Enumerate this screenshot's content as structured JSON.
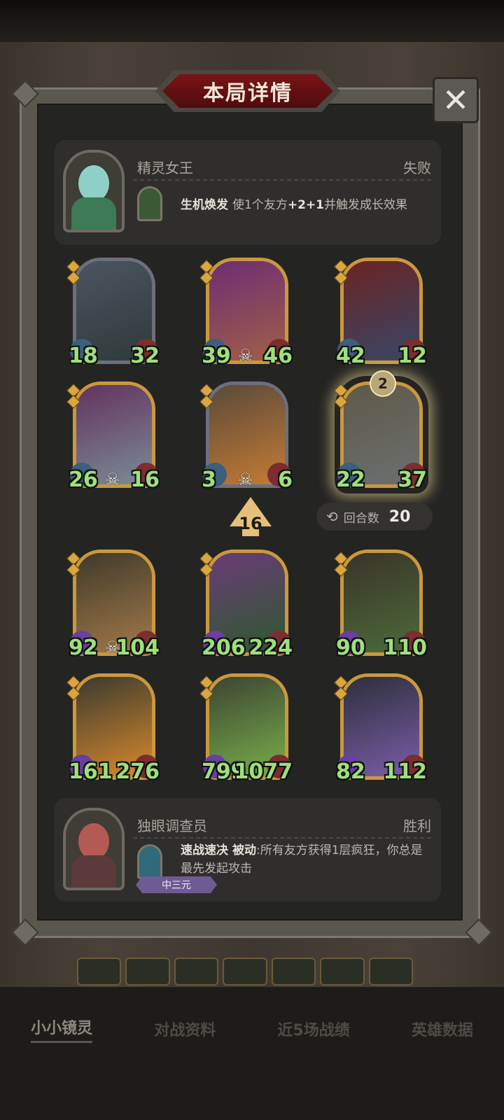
{
  "modal": {
    "title": "本局详情",
    "close_icon": "✕"
  },
  "top_player": {
    "name": "精灵女王",
    "result": "失败",
    "skill_name": "生机焕发",
    "skill_desc_pre": "使1个友方",
    "skill_desc_bold": "+2+1",
    "skill_desc_post": "并触发成长效果"
  },
  "top_cards": [
    {
      "atk": "18",
      "hp": "32",
      "skull": false,
      "frame": "gray",
      "colors": [
        "#4a5560",
        "#2f3a3a"
      ]
    },
    {
      "atk": "39",
      "hp": "46",
      "skull": true,
      "frame": "gold",
      "colors": [
        "#6d2e74",
        "#a15f46"
      ]
    },
    {
      "atk": "42",
      "hp": "12",
      "skull": false,
      "frame": "gold",
      "colors": [
        "#6a2424",
        "#384766"
      ]
    },
    {
      "atk": "26",
      "hp": "16",
      "skull": true,
      "frame": "gold",
      "colors": [
        "#63325f",
        "#7b8c96"
      ]
    },
    {
      "atk": "3",
      "hp": "6",
      "skull": true,
      "frame": "gray",
      "colors": [
        "#5a4a3a",
        "#c57b34"
      ]
    },
    {
      "atk": "22",
      "hp": "37",
      "skull": false,
      "frame": "gold",
      "colors": [
        "#5f5a48",
        "#6b6f70"
      ],
      "glow": true,
      "badge": "2"
    }
  ],
  "turn": {
    "arrow_value": "16",
    "rounds_icon": "⟲",
    "rounds_label": "回合数",
    "rounds_value": "20"
  },
  "bottom_cards": [
    {
      "atk": "92",
      "hp": "104",
      "skull": true,
      "colors": [
        "#3f3a2a",
        "#a47a4a"
      ]
    },
    {
      "atk": "206",
      "hp": "224",
      "skull": false,
      "colors": [
        "#6a3b77",
        "#2d5a2d"
      ]
    },
    {
      "atk": "90",
      "hp": "110",
      "skull": false,
      "colors": [
        "#3a3428",
        "#4c6b3a"
      ]
    },
    {
      "atk": "161",
      "hp": "276",
      "skull": false,
      "colors": [
        "#3b3a30",
        "#d98a2b"
      ]
    },
    {
      "atk": "799",
      "hp": "1077",
      "skull": false,
      "colors": [
        "#3c4433",
        "#78b049"
      ]
    },
    {
      "atk": "82",
      "hp": "112",
      "skull": false,
      "colors": [
        "#2c2f3c",
        "#7b5ea8"
      ]
    }
  ],
  "bottom_player": {
    "name": "独眼调查员",
    "result": "胜利",
    "skill_name": "速战速决",
    "skill_type": "被动",
    "skill_desc": ":所有友方获得1层疯狂，你总是最先发起攻击",
    "tag": "中三元"
  },
  "tabs": [
    "小小镜灵",
    "对战资料",
    "近5场战绩",
    "英雄数据"
  ],
  "colors": {
    "stat_green": "#9ee07c",
    "gold_frame": "#c9983f",
    "title_red": "#7a1416"
  }
}
